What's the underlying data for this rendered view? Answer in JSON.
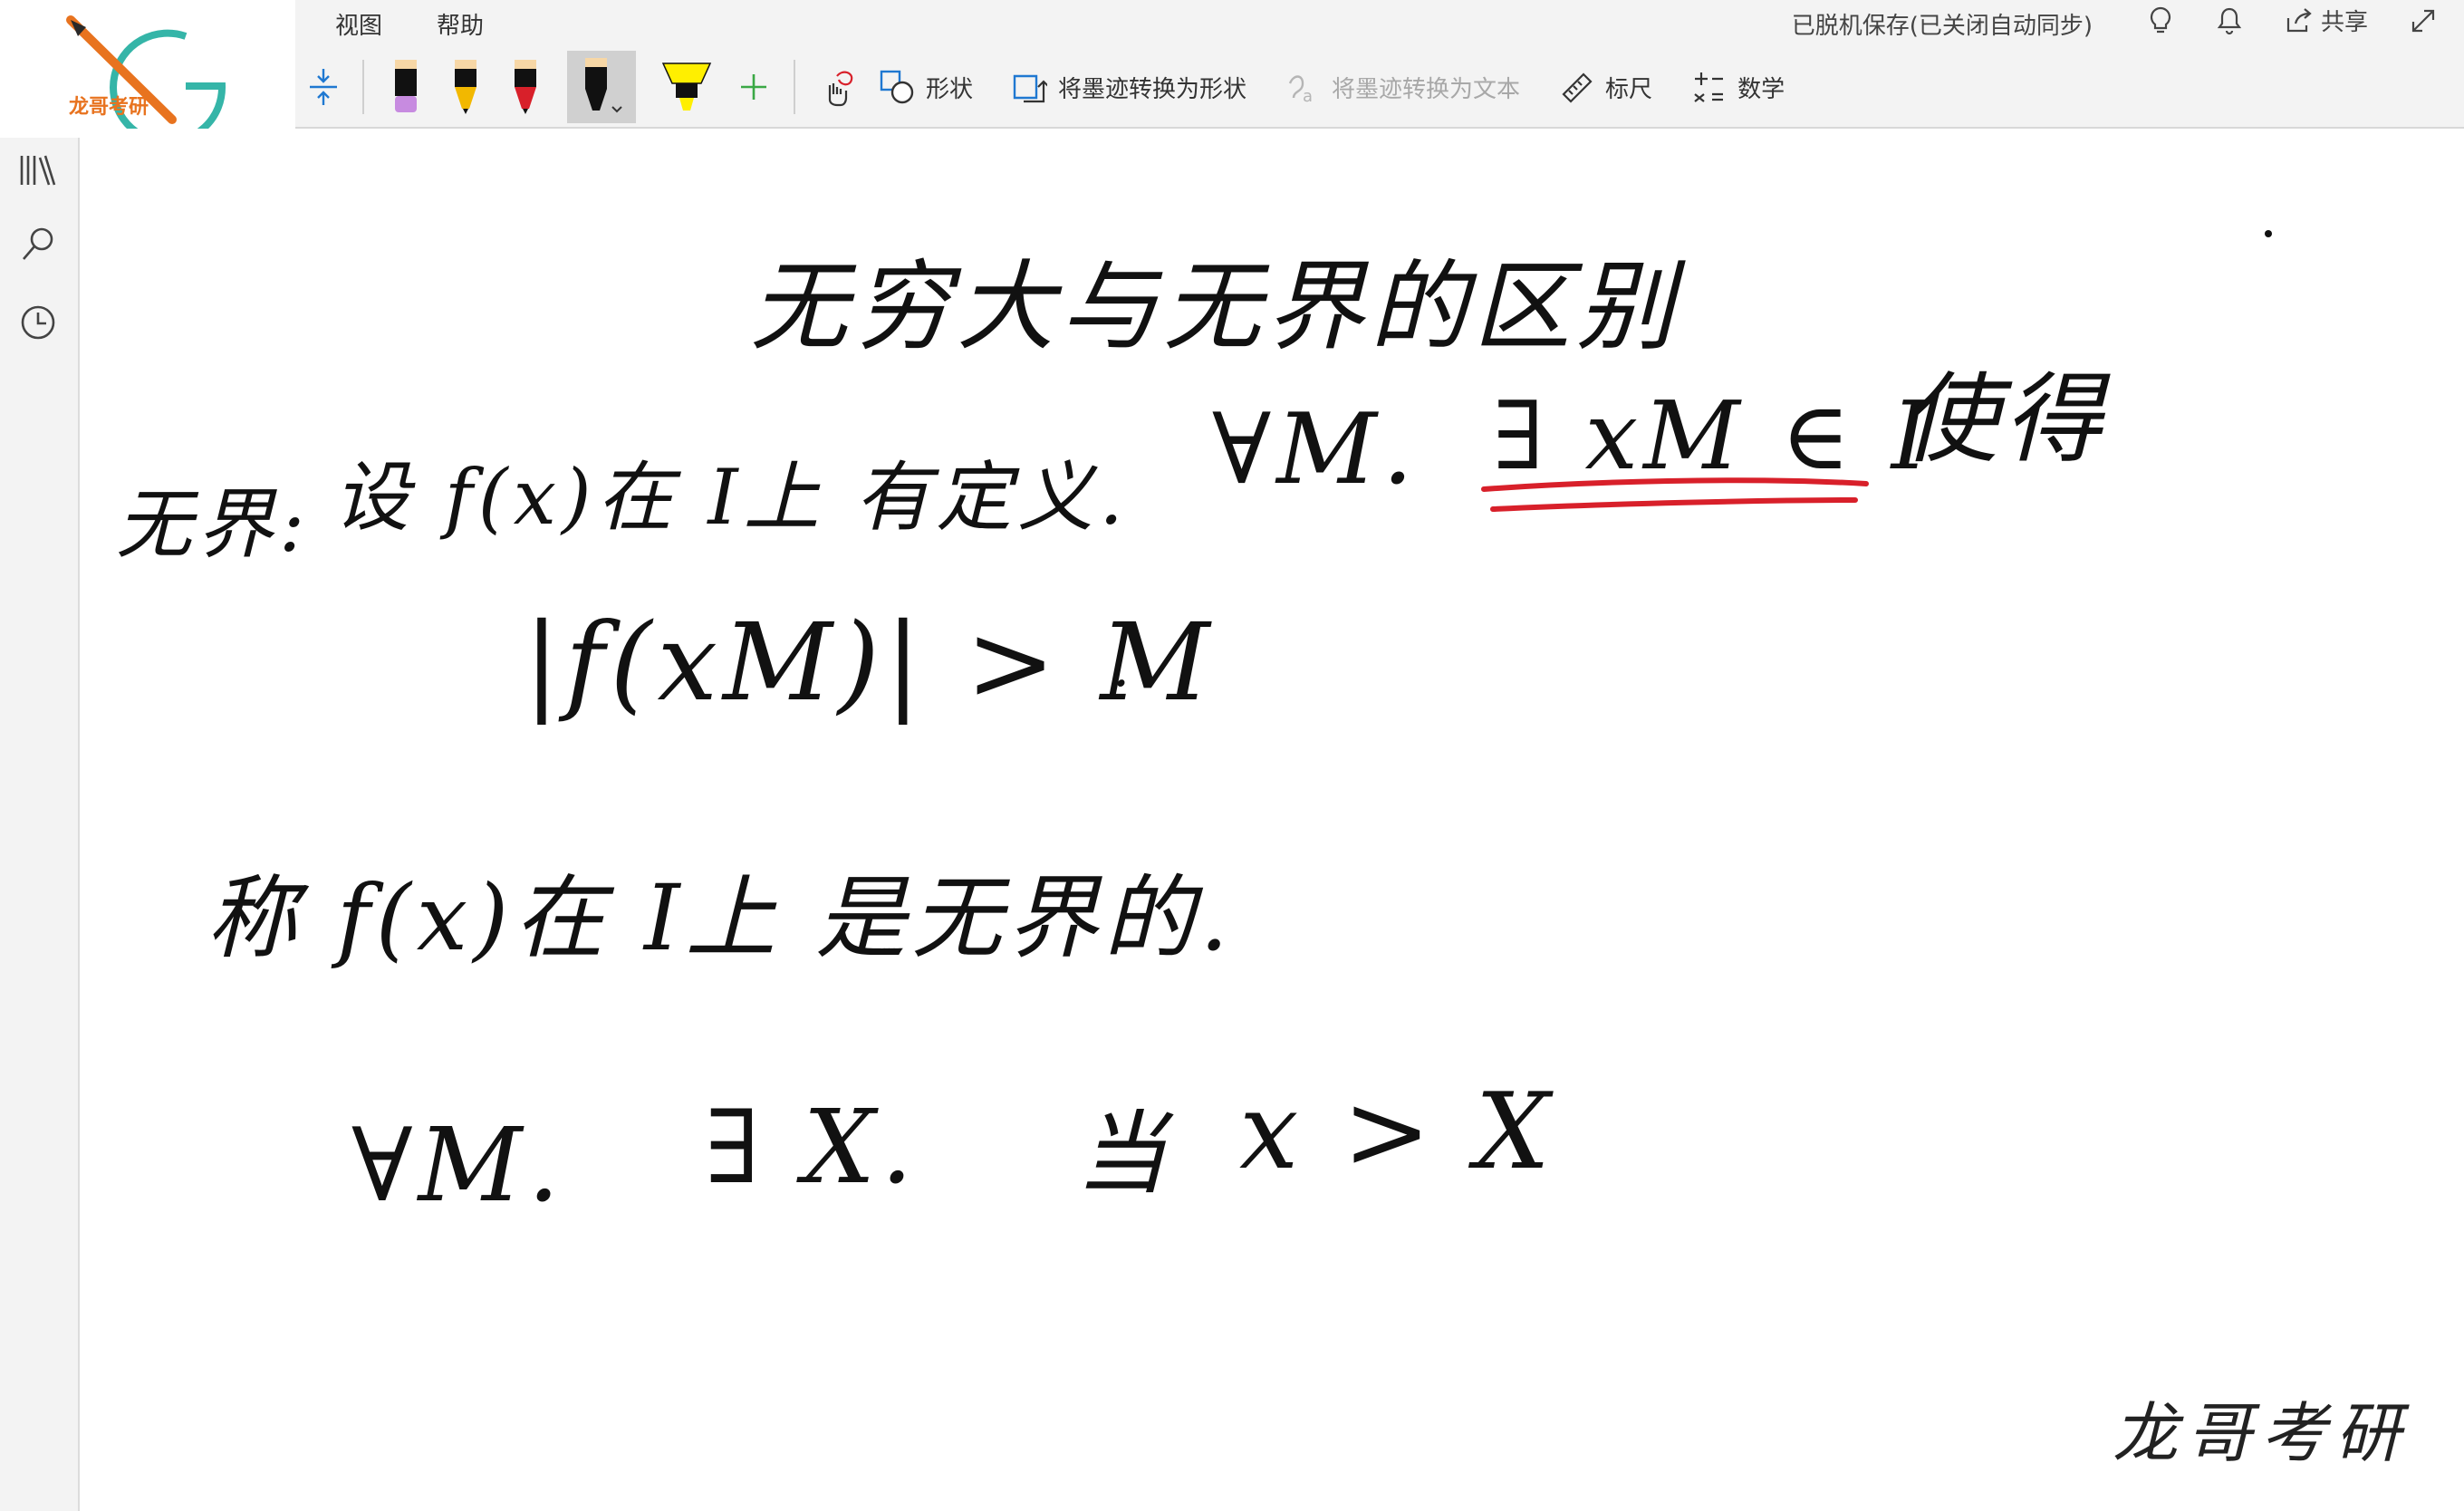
{
  "logo": {
    "text": "龙哥考研",
    "colors": {
      "pencil": "#e8731f",
      "ring": "#35b5a8"
    }
  },
  "menu": {
    "items": [
      "视图",
      "帮助"
    ]
  },
  "status": {
    "sync_text": "已脱机保存(已关闭自动同步)"
  },
  "top_actions": {
    "share_label": "共享"
  },
  "toolbar": {
    "pens": [
      {
        "name": "eraser-pen",
        "color": "#c78be0"
      },
      {
        "name": "pencil-yellow",
        "color": "#f2b800"
      },
      {
        "name": "pen-red",
        "color": "#d8202a"
      },
      {
        "name": "pen-black",
        "color": "#111111"
      },
      {
        "name": "highlighter-yellow",
        "color": "#ffef00"
      }
    ],
    "add_pen_icon": "plus-icon",
    "shapes_label": "形状",
    "ink_to_shape_label": "将墨迹转换为形状",
    "ink_to_text_label": "将墨迹转换为文本",
    "ruler_label": "标尺",
    "math_label": "数学"
  },
  "handwriting": {
    "title": "无穷大与无界的区别",
    "line1_label": "无界:",
    "line1_text": "设 f(x)在 I上 有定义.",
    "line1_forall": "∀M.",
    "line1_exists": "∃ xM ∈ I",
    "line1_suffix": "使得",
    "line2": "|f(xM)| > M",
    "line2_dot": ".",
    "line3": "称 f(x)在 I上 是无界的.",
    "line4_forall": "∀M.",
    "line4_exists": "∃ X.",
    "line4_when": "当",
    "line4_cond": "x > X"
  },
  "underline_color": "#d8202a",
  "watermark": "龙哥考研"
}
